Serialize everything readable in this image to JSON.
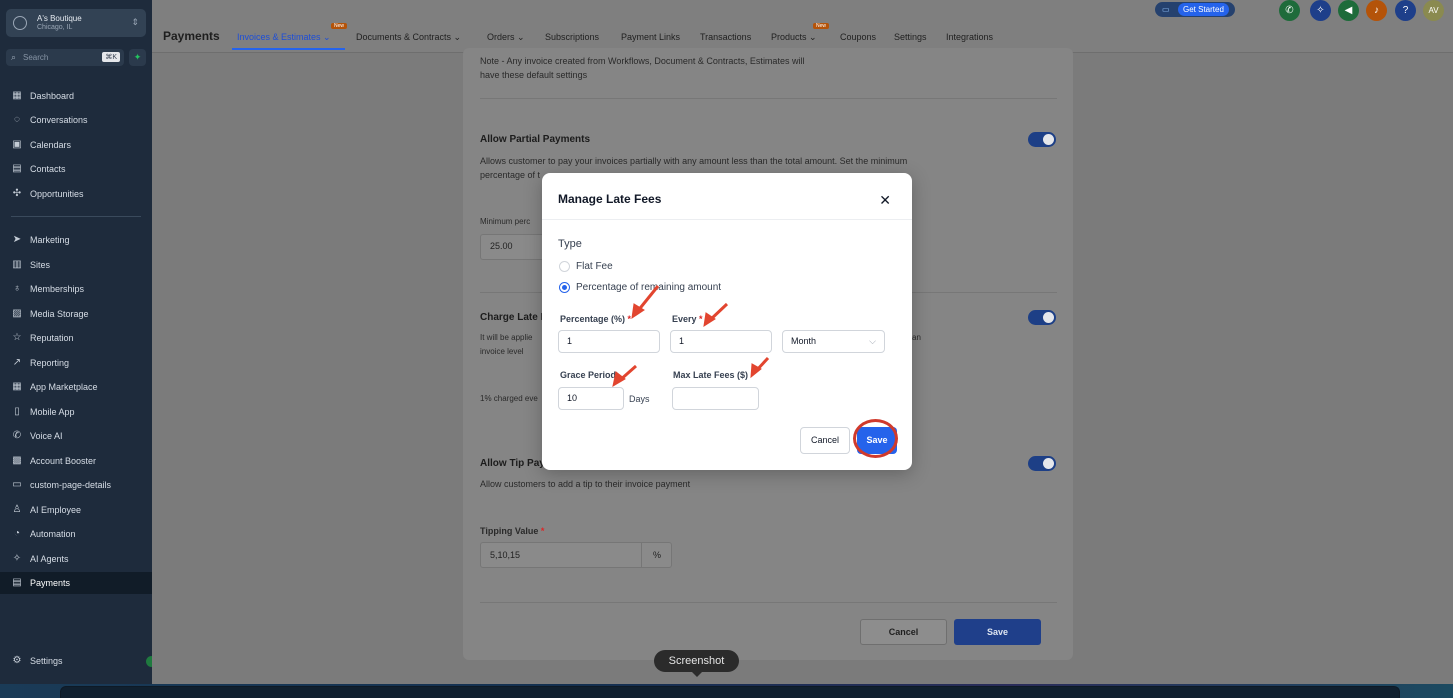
{
  "account": {
    "name": "A's Boutique",
    "city": "Chicago, IL"
  },
  "search": {
    "placeholder": "Search",
    "shortcut": "⌘K"
  },
  "sidebar": {
    "items": [
      {
        "label": "Dashboard",
        "icon": "dashboard-icon",
        "glyph": "▦"
      },
      {
        "label": "Conversations",
        "icon": "chat-icon",
        "glyph": "◌"
      },
      {
        "label": "Calendars",
        "icon": "calendar-icon",
        "glyph": "▣"
      },
      {
        "label": "Contacts",
        "icon": "contacts-icon",
        "glyph": "▤"
      },
      {
        "label": "Opportunities",
        "icon": "opportunities-icon",
        "glyph": "✣"
      },
      {
        "label": "Marketing",
        "icon": "send-icon",
        "glyph": "➤"
      },
      {
        "label": "Sites",
        "icon": "sites-icon",
        "glyph": "▥"
      },
      {
        "label": "Memberships",
        "icon": "membership-icon",
        "glyph": "♁"
      },
      {
        "label": "Media Storage",
        "icon": "image-icon",
        "glyph": "▨"
      },
      {
        "label": "Reputation",
        "icon": "reputation-icon",
        "glyph": "☆"
      },
      {
        "label": "Reporting",
        "icon": "trend-icon",
        "glyph": "↗"
      },
      {
        "label": "App Marketplace",
        "icon": "apps-icon",
        "glyph": "▦"
      },
      {
        "label": "Mobile App",
        "icon": "mobile-icon",
        "glyph": "▯"
      },
      {
        "label": "Voice AI",
        "icon": "phone-icon",
        "glyph": "✆"
      },
      {
        "label": "Account Booster",
        "icon": "booster-icon",
        "glyph": "▩"
      },
      {
        "label": "custom-page-details",
        "icon": "page-icon",
        "glyph": "▭"
      },
      {
        "label": "AI Employee",
        "icon": "person-icon",
        "glyph": "♙"
      },
      {
        "label": "Automation",
        "icon": "automation-icon",
        "glyph": "◔"
      },
      {
        "label": "AI Agents",
        "icon": "sparkle-icon",
        "glyph": "✧"
      },
      {
        "label": "Payments",
        "icon": "payments-icon",
        "glyph": "▤"
      }
    ],
    "settings": "Settings"
  },
  "header": {
    "title": "Payments",
    "tabs": [
      {
        "label": "Invoices & Estimates",
        "chevron": true,
        "new": true
      },
      {
        "label": "Documents & Contracts",
        "chevron": true,
        "new": false
      },
      {
        "label": "Orders",
        "chevron": true,
        "new": false
      },
      {
        "label": "Subscriptions",
        "chevron": false,
        "new": false
      },
      {
        "label": "Payment Links",
        "chevron": false,
        "new": false
      },
      {
        "label": "Transactions",
        "chevron": false,
        "new": false
      },
      {
        "label": "Products",
        "chevron": true,
        "new": true
      },
      {
        "label": "Coupons",
        "chevron": false,
        "new": false
      },
      {
        "label": "Settings",
        "chevron": false,
        "new": false
      },
      {
        "label": "Integrations",
        "chevron": false,
        "new": false
      }
    ],
    "new_badge": "New",
    "get_started": "Get Started",
    "avatar": "AV",
    "help": "?"
  },
  "card": {
    "note_line1": "Note - Any invoice created from Workflows, Document & Contracts, Estimates will",
    "note_line2": "have these default settings",
    "partial_title": "Allow Partial Payments",
    "partial_desc1": "Allows customer to pay your invoices partially with any amount less than the total amount. Set the minimum",
    "partial_desc2": "percentage of t",
    "min_label": "Minimum perc",
    "min_value": "25.00",
    "late_title": "Charge Late I",
    "late_desc1": "It will be applie",
    "late_desc1_tail": "an",
    "late_desc2": "invoice level",
    "late_summary": "1% charged eve",
    "tip_title": "Allow Tip Pay",
    "tip_desc": "Allow customers to add a tip to their invoice payment",
    "tipping_label": "Tipping Value",
    "tipping_value": "5,10,15",
    "tipping_unit": "%",
    "cancel": "Cancel",
    "save": "Save"
  },
  "modal": {
    "title": "Manage Late Fees",
    "type_label": "Type",
    "options": [
      "Flat Fee",
      "Percentage of remaining amount"
    ],
    "selected_option": 1,
    "percentage_label": "Percentage (%)",
    "percentage_value": "1",
    "every_label": "Every",
    "every_value": "1",
    "period_value": "Month",
    "grace_label": "Grace Period",
    "grace_value": "10",
    "grace_unit": "Days",
    "max_fees_label": "Max Late Fees ($)",
    "max_fees_value": "",
    "required_mark": "*",
    "cancel": "Cancel",
    "save": "Save"
  },
  "tooltip": "Screenshot",
  "colors": {
    "accent": "#2563eb",
    "sidebar": "#1e2b3c",
    "annotation": "#d03a2c"
  }
}
